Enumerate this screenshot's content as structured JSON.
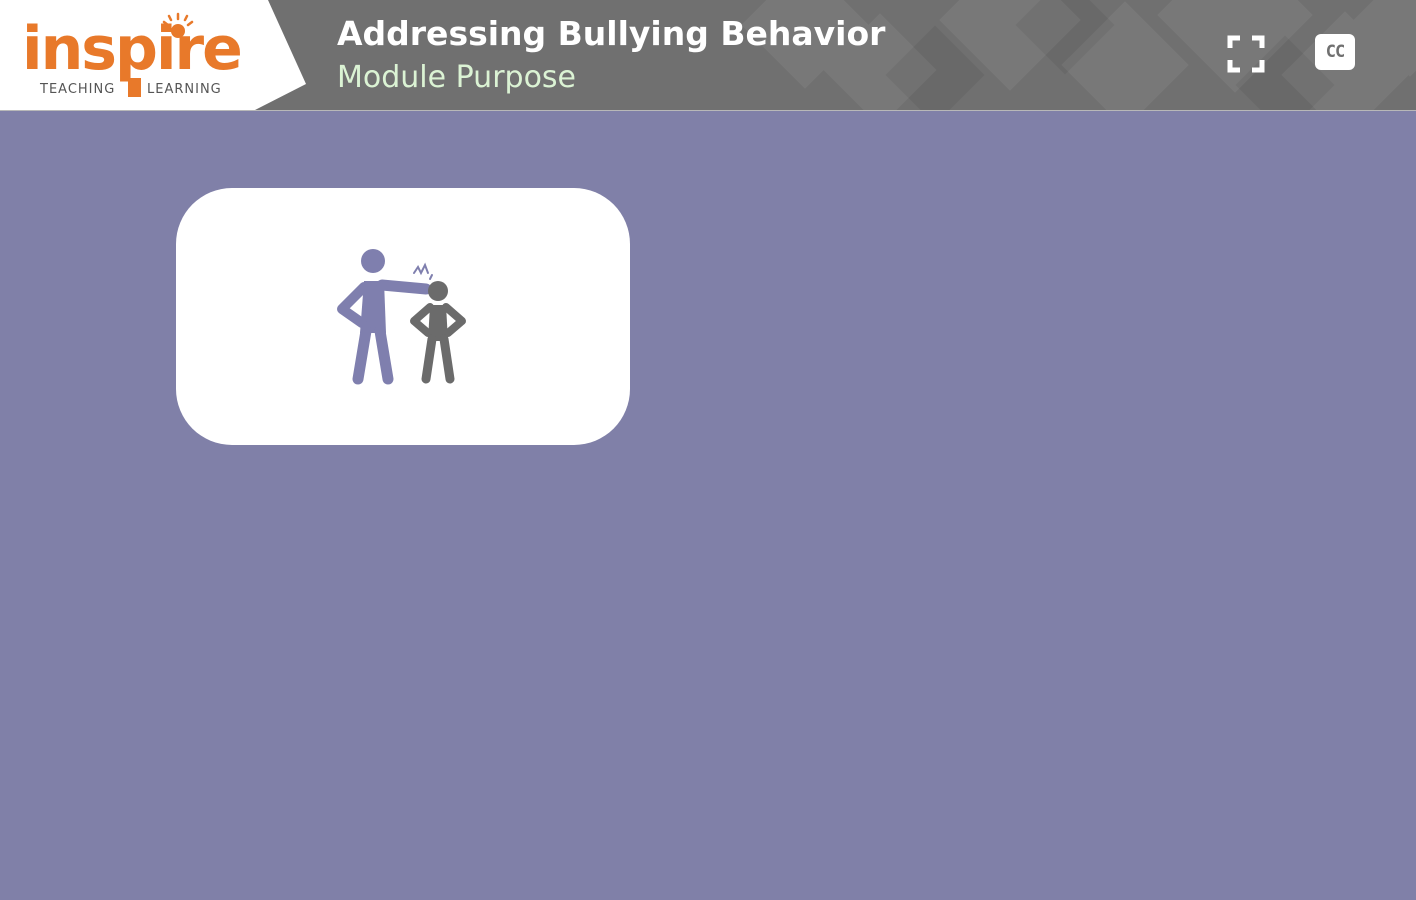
{
  "logo": {
    "word": "inspire",
    "tagline_left": "TEACHING",
    "tagline_right": "LEARNING",
    "brand_color": "#e8792a"
  },
  "header": {
    "title": "Addressing Bullying Behavior",
    "subtitle": "Module Purpose",
    "background_color": "#707070",
    "subtitle_color": "#dbf3d4"
  },
  "controls": {
    "fullscreen_icon": "fullscreen-icon",
    "cc_label": "CC"
  },
  "content": {
    "background_color": "#8080a8",
    "card_icon": "bullying-illustration-icon"
  }
}
